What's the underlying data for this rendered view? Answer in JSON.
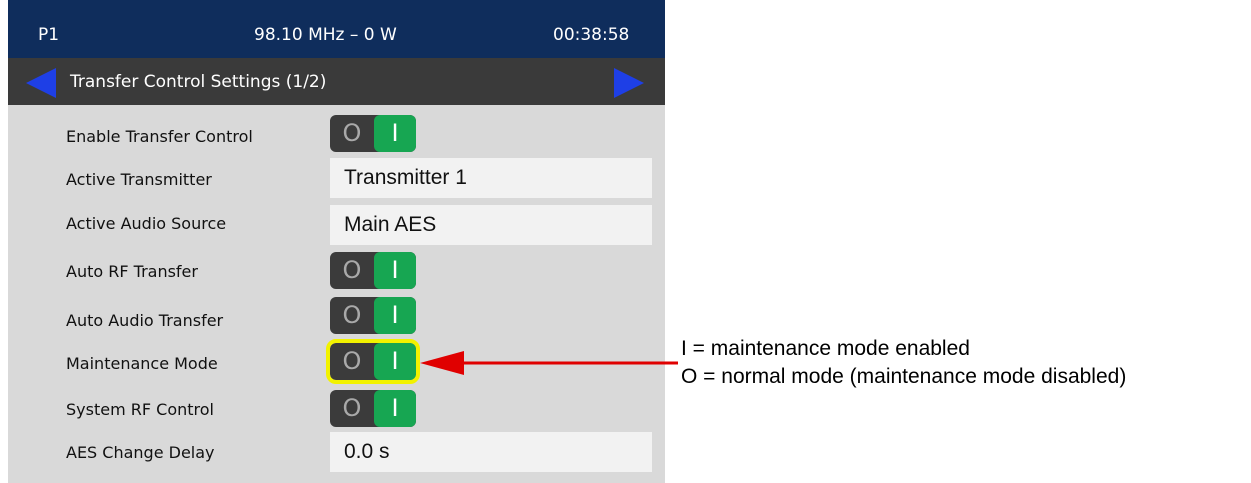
{
  "status_bar": {
    "preset": "P1",
    "frequency_power": "98.10 MHz – 0 W",
    "time": "00:38:58"
  },
  "title_bar": {
    "title": "Transfer Control Settings (1/2)",
    "prev_icon": "arrow-left-icon",
    "next_icon": "arrow-right-icon"
  },
  "toggle_glyphs": {
    "off": "O",
    "on": "I"
  },
  "settings": {
    "enable_transfer_control": {
      "label": "Enable Transfer Control",
      "state": "on"
    },
    "active_transmitter": {
      "label": "Active Transmitter",
      "value": "Transmitter 1"
    },
    "active_audio_source": {
      "label": "Active Audio Source",
      "value": "Main AES"
    },
    "auto_rf_transfer": {
      "label": "Auto RF Transfer",
      "state": "on"
    },
    "auto_audio_transfer": {
      "label": "Auto Audio Transfer",
      "state": "on"
    },
    "maintenance_mode": {
      "label": "Maintenance Mode",
      "state": "on",
      "highlighted": true
    },
    "system_rf_control": {
      "label": "System RF Control",
      "state": "on"
    },
    "aes_change_delay": {
      "label": "AES Change Delay",
      "value": "0.0 s"
    }
  },
  "annotation": {
    "line1": "I = maintenance mode enabled",
    "line2": "O = normal mode (maintenance mode disabled)"
  },
  "colors": {
    "status_bar_bg": "#0f2d5c",
    "title_bar_bg": "#3a3a3a",
    "screen_bg": "#d9d9d9",
    "toggle_on": "#17a652",
    "nav_arrow": "#1e3fe6",
    "highlight": "#f2f200",
    "callout_arrow": "#e00000"
  }
}
